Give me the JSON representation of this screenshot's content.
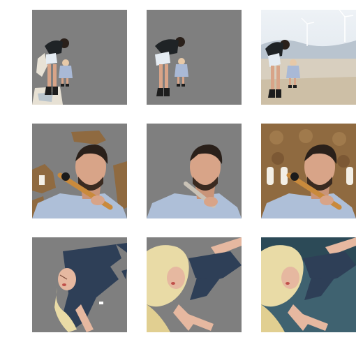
{
  "figure": {
    "rows": [
      {
        "name": "row-mother-child",
        "panels": [
          "masked-with-artifacts",
          "masked-clean",
          "original-with-background"
        ]
      },
      {
        "name": "row-man-flute",
        "panels": [
          "masked-with-artifacts",
          "masked-clean",
          "original-with-background"
        ]
      },
      {
        "name": "row-blonde-woman",
        "panels": [
          "masked-with-artifacts",
          "masked-clean",
          "original-with-background"
        ]
      }
    ],
    "colors": {
      "mask_gray": "#7f7f7f",
      "sky": "#dfe7ee",
      "ground": "#d8cfbf",
      "skin": "#d8a488",
      "hair_dark": "#2a201a",
      "shirt_blue": "#aebfd8",
      "flute": "#c98a3c",
      "wall_brown": "#8f6a40",
      "dress_navy": "#2e3f57",
      "hair_blonde": "#e9dba6",
      "teal_bg": "#3f6270"
    }
  }
}
